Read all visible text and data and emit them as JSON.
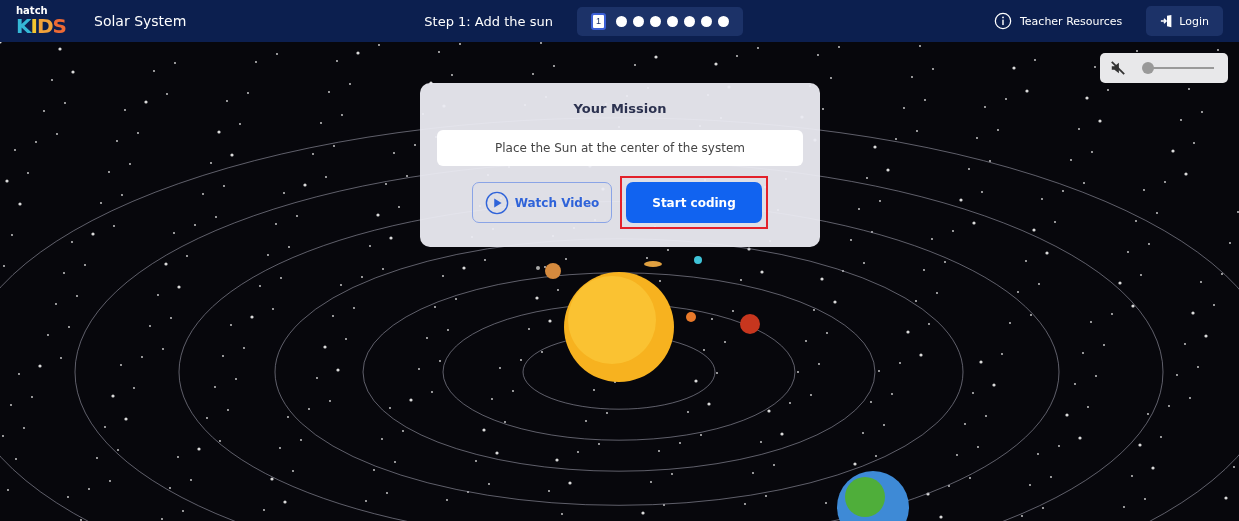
{
  "header": {
    "logo_top": "hatch",
    "logo_main": "KIDS",
    "title": "Solar System",
    "step_label": "Step 1: Add the sun",
    "steps": [
      {
        "label": "1",
        "selected": true
      },
      {
        "selected": false
      },
      {
        "selected": false
      },
      {
        "selected": false
      },
      {
        "selected": false
      },
      {
        "selected": false
      },
      {
        "selected": false
      },
      {
        "selected": false
      }
    ],
    "teacher_resources": "Teacher Resources",
    "login": "Login"
  },
  "volume": {
    "muted": true,
    "level": 0.05
  },
  "mission": {
    "title": "Your Mission",
    "text": "Place the Sun at the center of the system",
    "watch_video": "Watch Video",
    "start_coding": "Start coding",
    "start_highlighted": true
  }
}
